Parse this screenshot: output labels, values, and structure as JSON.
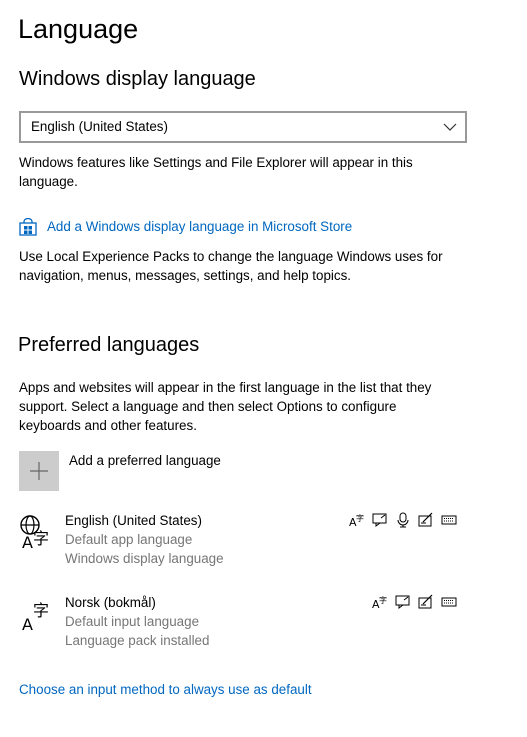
{
  "page": {
    "title": "Language"
  },
  "display_language": {
    "heading": "Windows display language",
    "selected": "English (United States)",
    "description": "Windows features like Settings and File Explorer will appear in this language.",
    "store_link": "Add a Windows display language in Microsoft Store",
    "packs_description": "Use Local Experience Packs to change the language Windows uses for navigation, menus, messages, settings, and help topics."
  },
  "preferred": {
    "heading": "Preferred languages",
    "description": "Apps and websites will appear in the first language in the list that they support. Select a language and then select Options to configure keyboards and other features.",
    "add_label": "Add a preferred language",
    "languages": [
      {
        "name": "English (United States)",
        "line1": "Default app language",
        "line2": "Windows display language",
        "features": [
          "text-to-speech-icon",
          "handwriting-icon",
          "speech-recognition-icon",
          "display-language-icon",
          "keyboard-icon"
        ]
      },
      {
        "name": "Norsk (bokmål)",
        "line1": "Default input language",
        "line2": "Language pack installed",
        "features": [
          "text-to-speech-icon",
          "handwriting-icon",
          "display-language-icon",
          "keyboard-icon"
        ]
      }
    ]
  },
  "footer_link": "Choose an input method to always use as default",
  "colors": {
    "link": "#0067c0",
    "secondary_text": "#767676",
    "tile": "#cccccc",
    "dropdown_border": "#999999"
  }
}
